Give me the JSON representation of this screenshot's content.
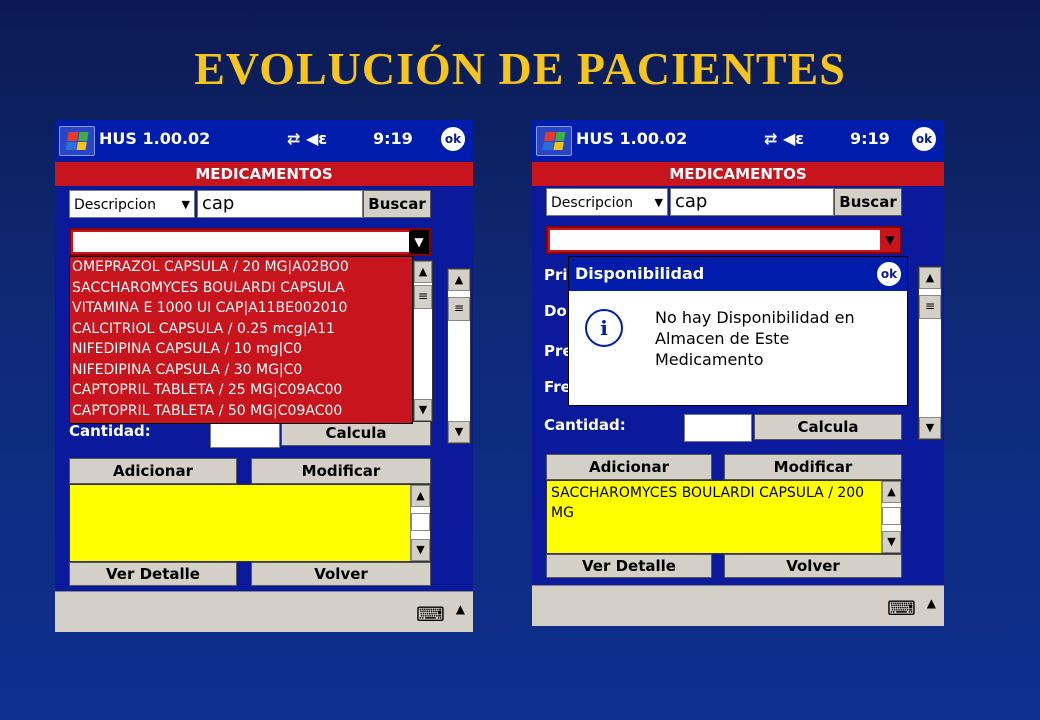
{
  "slide": {
    "title": "EVOLUCIÓN DE PACIENTES"
  },
  "app": {
    "title": "HUS 1.00.02",
    "status_icons": "⇄ ◀ε",
    "time": "9:19",
    "ok": "ok"
  },
  "form": {
    "header": "MEDICAMENTOS",
    "search_type": "Descripcion",
    "search_value": "cap",
    "search_button": "Buscar",
    "quantity_label": "Cantidad:",
    "calc_button": "Calcula",
    "add_button": "Adicionar",
    "modify_button": "Modificar",
    "detail_button": "Ver Detalle",
    "back_button": "Volver"
  },
  "left_screen": {
    "dropdown_items": [
      "OMEPRAZOL CAPSULA / 20 MG|A02BO0",
      "SACCHAROMYCES BOULARDI CAPSULA",
      "VITAMINA E 1000 UI CAP|A11BE002010",
      "CALCITRIOL CAPSULA    / 0.25 mcg|A11",
      "NIFEDIPINA CAPSULA /          10 mg|C0",
      "NIFEDIPINA CAPSULA /          30 MG|C0",
      "CAPTOPRIL TABLETA / 25 MG|C09AC00",
      "CAPTOPRIL TABLETA / 50 MG|C09AC00"
    ]
  },
  "right_screen": {
    "hidden_labels": [
      "Pri",
      "Do",
      "Pre",
      "Fre"
    ],
    "dialog_title": "Disponibilidad",
    "dialog_ok": "ok",
    "dialog_message": "No hay Disponibilidad en Almacen de Este Medicamento",
    "selected_list": "SACCHAROMYCES BOULARDI CAPSULA / 200 MG"
  }
}
